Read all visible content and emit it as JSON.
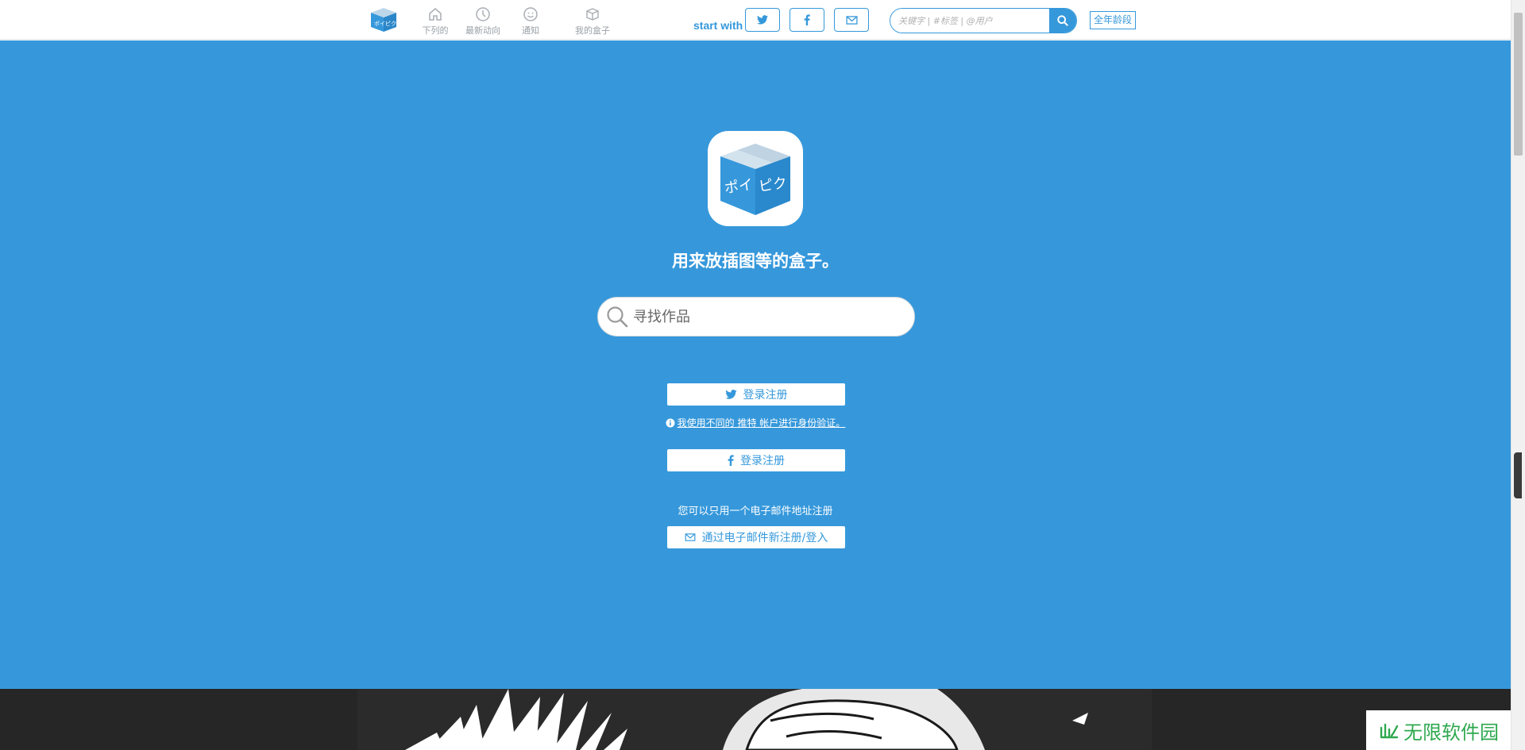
{
  "header": {
    "nav": [
      {
        "label": "下列的",
        "icon": "home-icon"
      },
      {
        "label": "最新动向",
        "icon": "clock-icon"
      },
      {
        "label": "通知",
        "icon": "chat-icon"
      },
      {
        "label": "我的盒子",
        "icon": "box-icon"
      }
    ],
    "start_with": "start with",
    "search_placeholder": "关键字 | #标签 | @用户",
    "age_label": "全年龄段"
  },
  "hero": {
    "tagline": "用来放插图等的盒子。",
    "search_placeholder": "寻找作品",
    "twitter_login": "登录注册",
    "twitter_note": "我使用不同的 推特 帐户进行身份验证。",
    "facebook_login": "登录注册",
    "email_note": "您可以只用一个电子邮件地址注册",
    "email_login": "通过电子邮件新注册/登入"
  },
  "logo_text": "ポイピク",
  "watermark": "无限软件园",
  "colors": {
    "brand": "#3698db",
    "banner": "#262626",
    "watermark": "#2fa84f"
  }
}
